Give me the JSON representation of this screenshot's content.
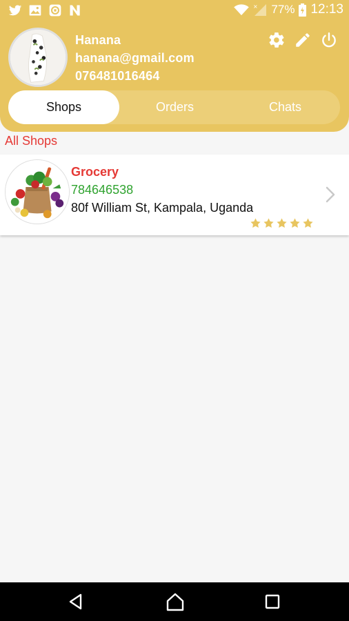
{
  "status_bar": {
    "left_icons": [
      "twitter-icon",
      "image-icon",
      "app-icon",
      "n-icon"
    ],
    "battery": "77%",
    "time": "12:13"
  },
  "profile": {
    "name": "Hanana",
    "email": "hanana@gmail.com",
    "phone": "076481016464"
  },
  "header_actions": [
    "settings-icon",
    "edit-icon",
    "power-icon"
  ],
  "tabs": [
    {
      "label": "Shops",
      "active": true
    },
    {
      "label": "Orders",
      "active": false
    },
    {
      "label": "Chats",
      "active": false
    }
  ],
  "section_label": "All Shops",
  "shops": [
    {
      "name": "Grocery",
      "phone": "784646538",
      "address": "80f William St, Kampala, Uganda",
      "rating": 5,
      "rating_max": 5
    }
  ],
  "colors": {
    "header": "#e8c560",
    "accent_red": "#e53935",
    "phone_green": "#2fa32f",
    "star": "#e8c560"
  },
  "nav_bar": [
    "back-icon",
    "home-icon",
    "recents-icon"
  ]
}
